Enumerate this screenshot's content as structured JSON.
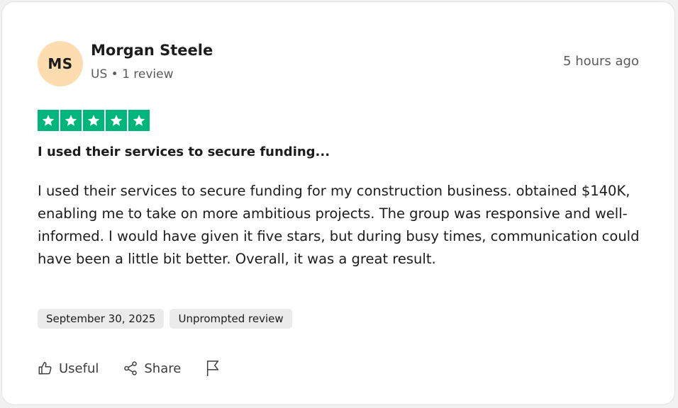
{
  "reviewer": {
    "initials": "MS",
    "name": "Morgan Steele",
    "meta": "US • 1 review",
    "avatar_color": "#fddcb0"
  },
  "review": {
    "time_ago": "5 hours ago",
    "rating": 5,
    "rating_max": 5,
    "star_color": "#00b67a",
    "headline": "I used their services to secure funding...",
    "body": "I used their services to secure funding for my construction business. obtained $140K, enabling me to take on more ambitious projects. The group was responsive and well-informed. I would have given it five stars, but during busy times, communication could have been a little bit better. Overall, it was a great result.",
    "tags": [
      "September 30, 2025",
      "Unprompted review"
    ]
  },
  "actions": {
    "useful_label": "Useful",
    "share_label": "Share",
    "icons": [
      "thumbs-up-icon",
      "share-icon",
      "flag-icon"
    ]
  }
}
